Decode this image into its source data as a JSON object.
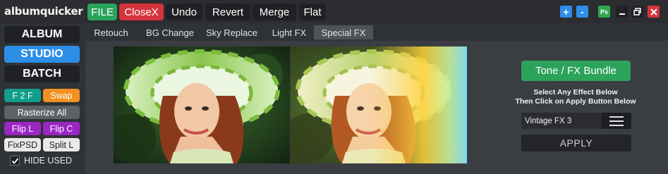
{
  "app": {
    "logo_text": "albumquicker"
  },
  "toolbar": {
    "file": "FILE",
    "closex": "CloseX",
    "undo": "Undo",
    "revert": "Revert",
    "merge": "Merge",
    "flat": "Flat",
    "plus": "+",
    "minus": "-",
    "ps": "Ps"
  },
  "modes": {
    "album": "ALBUM",
    "studio": "STUDIO",
    "batch": "BATCH"
  },
  "tools": {
    "f2f": "F 2 F",
    "swap": "Swap",
    "rasterize": "Rasterize All",
    "flip_l": "Flip L",
    "flip_c": "Flip C",
    "fixpsd": "FixPSD",
    "split_l": "Split L",
    "hide_used": "HIDE USED",
    "hide_used_checked": true
  },
  "tabs": [
    "Retouch",
    "BG Change",
    "Sky Replace",
    "Light FX",
    "Special FX"
  ],
  "active_tab": "Special FX",
  "effects": {
    "bundle_button": "Tone / FX Bundle",
    "instruction_line1": "Select Any Effect Below",
    "instruction_line2": "Then Click on Apply Button Below",
    "selected_effect": "Vintage FX 3",
    "apply_button": "APPLY"
  },
  "colors": {
    "green": "#2ba35a",
    "red": "#d6343d",
    "blue": "#2d8ee8",
    "teal": "#0f9e8a",
    "orange": "#f29123",
    "purple": "#9a27c2"
  }
}
